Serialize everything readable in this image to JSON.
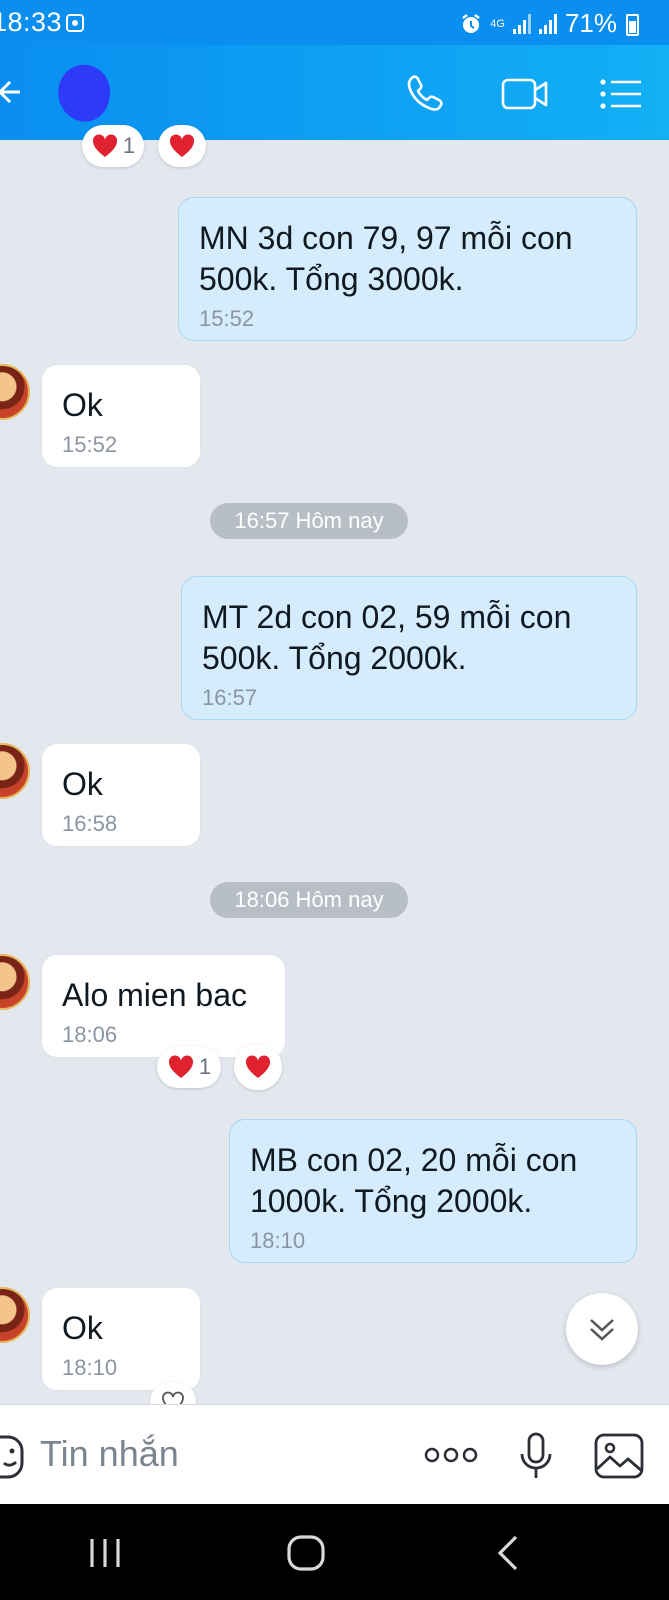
{
  "status_bar": {
    "time": "18:33",
    "network": "4G",
    "battery": "71%"
  },
  "header": {
    "icons": [
      "back-arrow-icon",
      "phone-icon",
      "video-call-icon",
      "menu-list-icon"
    ]
  },
  "messages": [
    {
      "direction": "out",
      "text": "MN 3d con 79, 97 mỗi con\n500k. Tổng 3000k.",
      "time": "15:52"
    },
    {
      "direction": "in",
      "text": "Ok",
      "time": "15:52"
    },
    {
      "type": "separator",
      "text": "16:57 Hôm nay"
    },
    {
      "direction": "out",
      "text": "MT 2d con 02, 59 mỗi con\n500k. Tổng 2000k.",
      "time": "16:57"
    },
    {
      "direction": "in",
      "text": "Ok",
      "time": "16:58"
    },
    {
      "type": "separator",
      "text": "18:06 Hôm nay"
    },
    {
      "direction": "in",
      "text": "Alo mien bac",
      "time": "18:06",
      "reaction_count": "1"
    },
    {
      "direction": "out",
      "text": "MB con 02, 20 mỗi con\n1000k. Tổng 2000k.",
      "time": "18:10"
    },
    {
      "direction": "in",
      "text": "Ok",
      "time": "18:10"
    }
  ],
  "top_reaction": {
    "count": "1"
  },
  "composer": {
    "placeholder": "Tin nhắn",
    "icons": [
      "sticker-icon",
      "more-dots-icon",
      "microphone-icon",
      "image-icon"
    ]
  },
  "nav_bar": {
    "icons": [
      "recent-apps-icon",
      "home-icon",
      "back-icon"
    ]
  },
  "colors": {
    "header_blue": "#0a8ef0",
    "outgoing_bubble": "#d4ecfb",
    "incoming_bubble": "#ffffff",
    "heart_red": "#e0212f"
  }
}
